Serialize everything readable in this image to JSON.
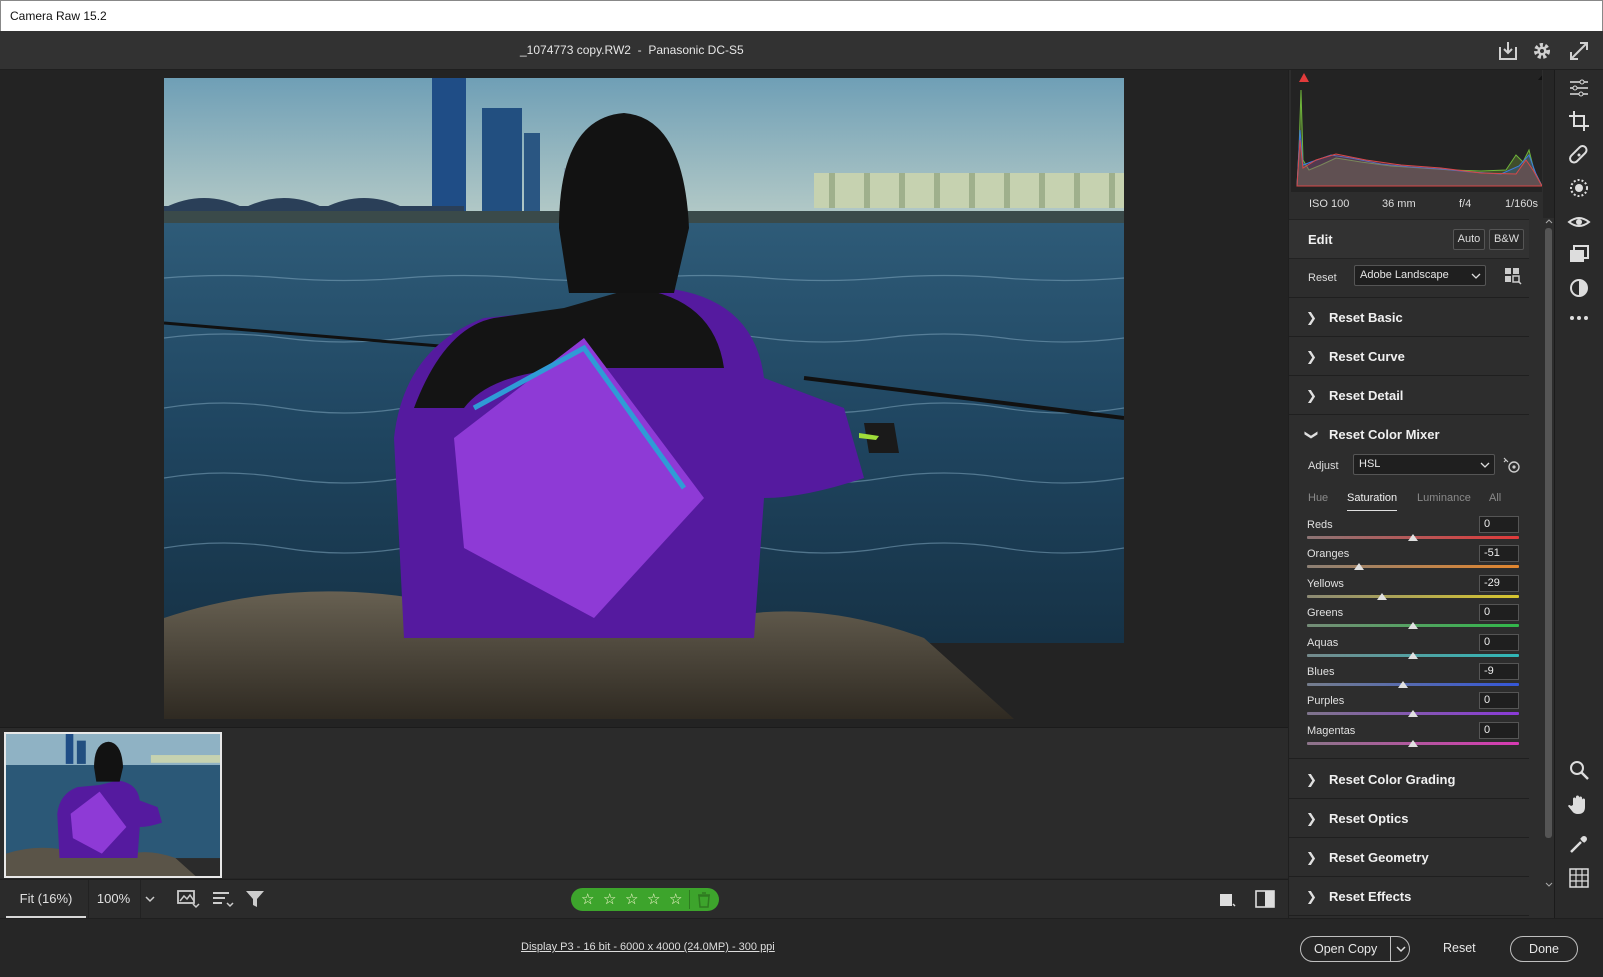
{
  "app": {
    "title": "Camera Raw 15.2"
  },
  "header": {
    "filename": "_1074773 copy.RW2",
    "separator": "-",
    "camera": "Panasonic DC-S5"
  },
  "exif": {
    "iso": "ISO 100",
    "focal": "36 mm",
    "aperture": "f/4",
    "shutter": "1/160s"
  },
  "edit": {
    "title": "Edit",
    "auto_label": "Auto",
    "bw_label": "B&W",
    "profile_label": "Reset",
    "profile_value": "Adobe Landscape"
  },
  "sections": {
    "basic": "Reset Basic",
    "curve": "Reset Curve",
    "detail": "Reset Detail",
    "color_mixer": "Reset Color Mixer",
    "color_grading": "Reset Color Grading",
    "optics": "Reset Optics",
    "geometry": "Reset Geometry",
    "effects": "Reset Effects"
  },
  "color_mixer": {
    "adjust_label": "Adjust",
    "adjust_value": "HSL",
    "tabs": [
      "Hue",
      "Saturation",
      "Luminance",
      "All"
    ],
    "active_tab": "Saturation",
    "sliders": [
      {
        "name": "Reds",
        "value": "0",
        "level": 0
      },
      {
        "name": "Oranges",
        "value": "-51",
        "level": -51
      },
      {
        "name": "Yellows",
        "value": "-29",
        "level": -29
      },
      {
        "name": "Greens",
        "value": "0",
        "level": 0
      },
      {
        "name": "Aquas",
        "value": "0",
        "level": 0
      },
      {
        "name": "Blues",
        "value": "-9",
        "level": -9
      },
      {
        "name": "Purples",
        "value": "0",
        "level": 0
      },
      {
        "name": "Magentas",
        "value": "0",
        "level": 0
      }
    ],
    "slider_range": [
      -100,
      100
    ]
  },
  "zoom": {
    "fit_label": "Fit (16%)",
    "percent_label": "100%"
  },
  "rating": {
    "stars": 5
  },
  "footer": {
    "info": "Display P3 - 16 bit - 6000 x 4000 (24.0MP) - 300 ppi",
    "open_copy_label": "Open Copy",
    "reset_label": "Reset",
    "done_label": "Done"
  },
  "colors": {
    "accent_green": "#3da42c",
    "panel_bg": "#2d2d2d",
    "viewer_bg": "#232323"
  }
}
